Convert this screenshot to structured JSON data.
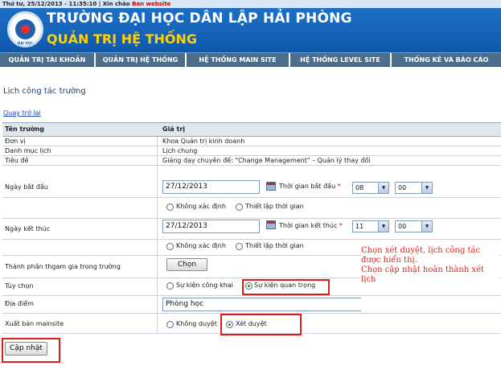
{
  "top_strip": {
    "datetime": "Thứ tư, 25/12/2013 - 11:35:10",
    "separator": "|",
    "greeting": "Xin chào",
    "user": "Ban website"
  },
  "header": {
    "logo_text": "ĐẠI HỌC",
    "title": "TRƯỜNG ĐẠI HỌC DÂN LẬP HẢI PHÒNG",
    "subtitle": "QUẢN TRỊ HỆ THỐNG"
  },
  "nav": [
    "QUẢN TRỊ TÀI KHOẢN",
    "QUẢN TRỊ HỆ THỐNG",
    "HỆ THỐNG MAIN SITE",
    "HỆ THỐNG LEVEL SITE",
    "THỐNG KÊ VÀ BÁO CÁO"
  ],
  "page_title": "Lịch công tác trường",
  "back_link": "Quay trở lại",
  "table": {
    "col_name": "Tên trường",
    "col_value": "Giá trị",
    "don_vi": {
      "label": "Đơn vị",
      "value": "Khoa Quản trị kinh doanh"
    },
    "danh_muc": {
      "label": "Danh mục lịch",
      "value": "Lịch chung"
    },
    "tieu_de": {
      "label": "Tiêu đề",
      "value": "Giảng dạy chuyên đề: \"Change Management\" – Quản lý thay đổi"
    },
    "ngay_bat_dau": {
      "label": "Ngày bắt đầu",
      "date": "27/12/2013",
      "time_label": "Thời gian bắt đầu",
      "required": "*",
      "hour": "08",
      "minute": "00"
    },
    "ngay_ket_thuc": {
      "label": "Ngày kết thúc",
      "date": "27/12/2013",
      "time_label": "Thời gian kết thúc",
      "required": "*",
      "hour": "11",
      "minute": "00"
    },
    "time_options": {
      "opt1": "Không xác định",
      "opt2": "Thiết lập thời gian"
    },
    "thanh_phan": {
      "label": "Thành phần thgam gia trong trường",
      "button": "Chọn"
    },
    "tuy_chon": {
      "label": "Tùy chọn",
      "opt1": "Sự kiện công khai",
      "opt2": "Sự kiện quan trọng"
    },
    "dia_diem": {
      "label": "Địa điểm",
      "value": "Phòng học"
    },
    "xuat_ban": {
      "label": "Xuất bản mainsite",
      "opt1": "Không duyệt",
      "opt2": "Xét duyệt"
    }
  },
  "submit_button": "Cập nhật",
  "annotation": {
    "line1": "Chọn xét duyệt, lịch công tác",
    "line2": "được hiển thị.",
    "line3": "Chọn cập nhật hoàn thành xét",
    "line4": "lịch"
  },
  "colors": {
    "header_blue": "#1d6fc4",
    "subtitle_yellow": "#ffd200",
    "nav_bg": "#4a6e8c",
    "highlight_red": "#e01b1b"
  }
}
